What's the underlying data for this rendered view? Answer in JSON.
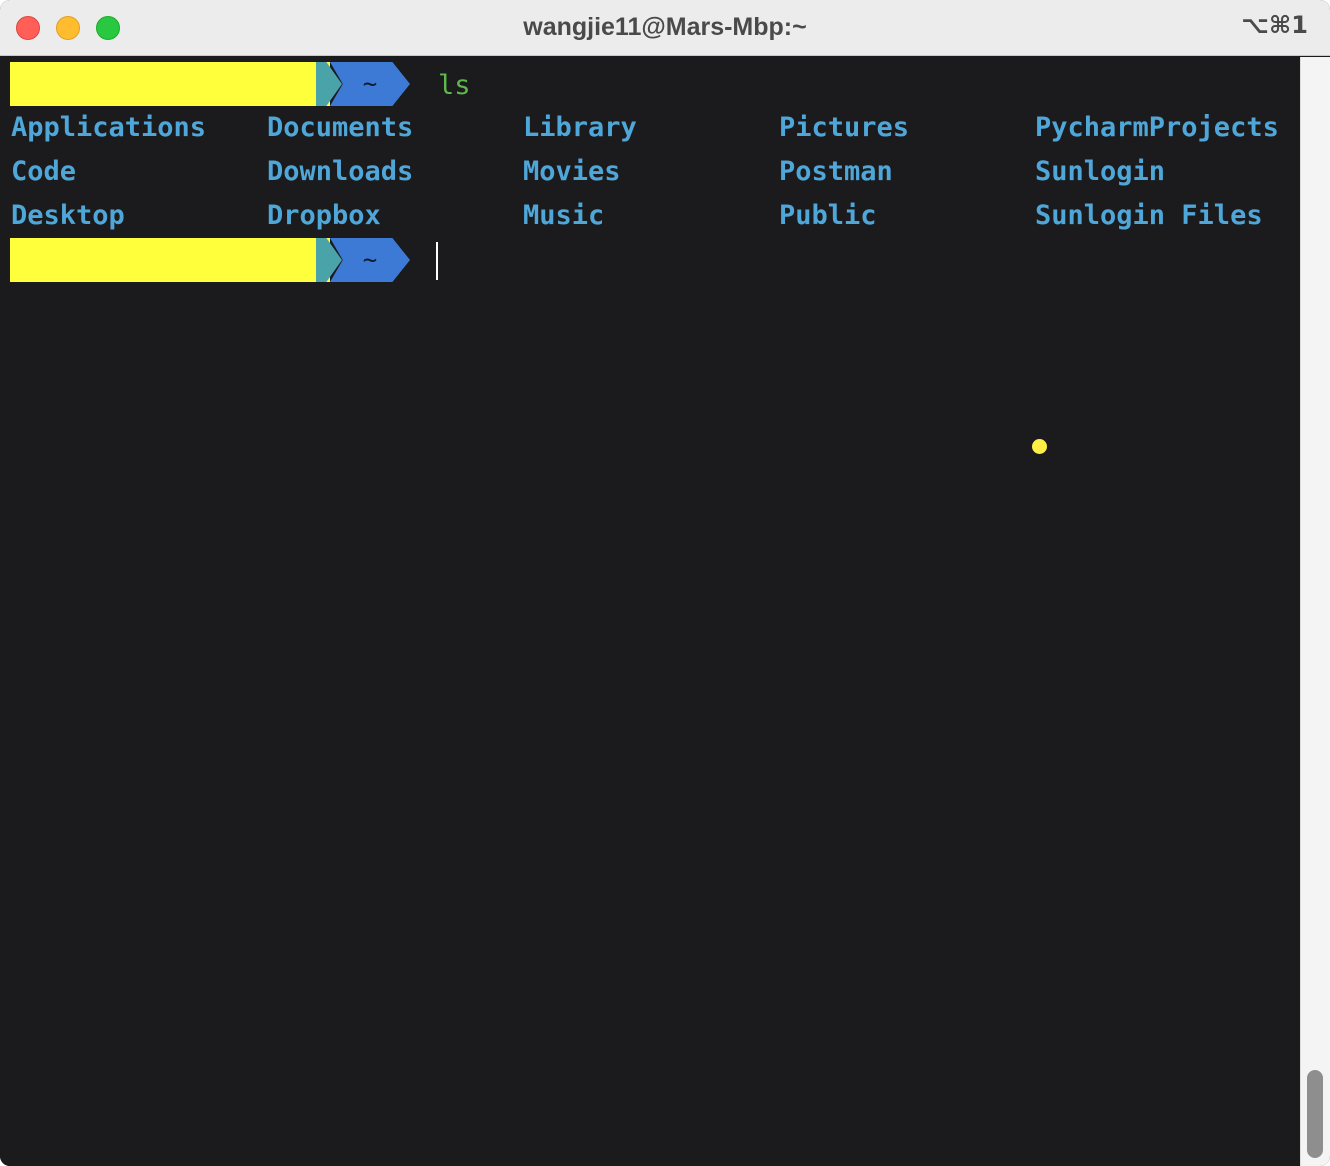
{
  "window": {
    "title": "wangjie11@Mars-Mbp:~",
    "shortcut": "⌥⌘1"
  },
  "prompt": {
    "directory": "~",
    "command": "ls"
  },
  "listing": {
    "columns": [
      [
        "Applications",
        "Code",
        "Desktop"
      ],
      [
        "Documents",
        "Downloads",
        "Dropbox"
      ],
      [
        "Library",
        "Movies",
        "Music"
      ],
      [
        "Pictures",
        "Postman",
        "Public"
      ],
      [
        "PycharmProjects",
        "Sunlogin",
        "Sunlogin Files"
      ]
    ]
  },
  "colors": {
    "directory_entry": "#4ea7d8",
    "command": "#5fb84c",
    "prompt_dir_segment": "#3d7ad6",
    "redaction": "#ffff3c",
    "background": "#1b1a1c"
  }
}
